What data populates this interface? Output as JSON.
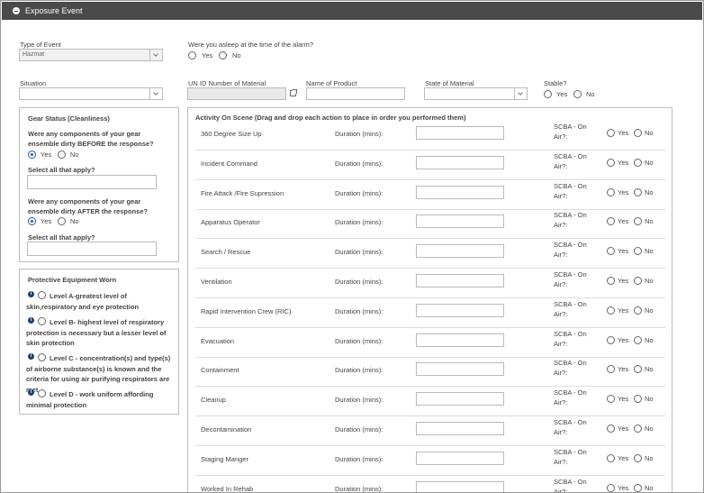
{
  "header": {
    "title": "Exposure Event"
  },
  "type_of_event": {
    "label": "Type of Event",
    "value": "Hazmat"
  },
  "asleep": {
    "question": "Were you asleep at the time of the alarm?",
    "yes": "Yes",
    "no": "No"
  },
  "situation": {
    "label": "Situation",
    "value": ""
  },
  "un_id": {
    "label": "UN ID Number of Material",
    "value": ""
  },
  "product": {
    "label": "Name of Product",
    "value": ""
  },
  "state_material": {
    "label": "State of Material",
    "value": ""
  },
  "stable": {
    "label": "Stable?",
    "yes": "Yes",
    "no": "No"
  },
  "gear_status": {
    "title": "Gear Status (Cleanliness)",
    "q_before": "Were any components of your gear ensemble dirty BEFORE the response?",
    "q_after": "Were any components of your gear ensemble dirty AFTER the response?",
    "select_all": "Select all that apply?",
    "yes": "Yes",
    "no": "No"
  },
  "protective": {
    "title": "Protective Equipment Worn",
    "levels": [
      {
        "text": "Level A-greatest level of skin,respiratory and eye protection"
      },
      {
        "text": "Level B- highest level of respiratory protection is necessary but a lesser level of skin protection"
      },
      {
        "text": "Level C - concentration(s) and type(s) of airborne substance(s) is known and the criteria for using air purifying respirators are met"
      },
      {
        "text": "Level D - work uniform affording minimal protection"
      }
    ]
  },
  "activity": {
    "title": "Activity On Scene (Drag and drop each action to place in order you performed them)",
    "duration_label": "Duration (mins):",
    "scba_label": "SCBA - On Air?:",
    "yes": "Yes",
    "no": "No",
    "rows": [
      "360 Degree Size Up",
      "Incident Command",
      "Fire Attack /Fire Supression",
      "Apparatus Operator",
      "Search / Rescue",
      "Ventilation",
      "Rapid Intervention Crew (RIC)",
      "Evacuation",
      "Containment",
      "Cleanup",
      "Decontamination",
      "Staging Manger",
      "Worked In Rehab"
    ]
  },
  "colors": {
    "header_bg": "#4a4a4a",
    "radio_selected": "#1f5aa8",
    "info_icon": "#1d3f73"
  }
}
